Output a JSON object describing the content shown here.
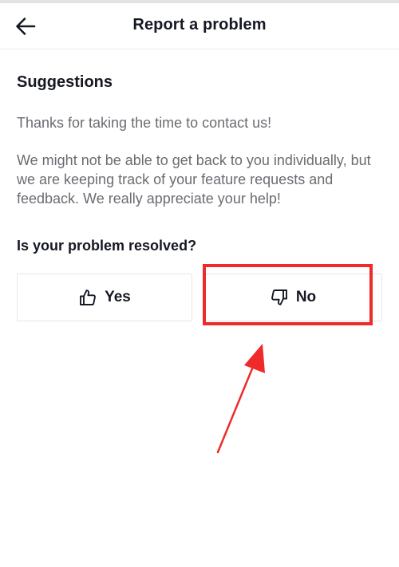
{
  "header": {
    "title": "Report a problem",
    "back_icon": "arrow-left-icon"
  },
  "content": {
    "section_heading": "Suggestions",
    "paragraph_1": "Thanks for taking the time to contact us!",
    "paragraph_2": "We might not be able to get back to you individually, but we are keeping track of your feature requests and feedback. We really appreciate your help!",
    "question": "Is your problem resolved?"
  },
  "answers": {
    "yes": {
      "label": "Yes",
      "icon": "thumbs-up-icon"
    },
    "no": {
      "label": "No",
      "icon": "thumbs-down-icon"
    }
  },
  "annotation": {
    "highlight_color": "#ef2a2a",
    "target": "no"
  },
  "colors": {
    "text_primary": "#161823",
    "text_secondary": "#6b6c72",
    "border": "#e6e6e8"
  }
}
